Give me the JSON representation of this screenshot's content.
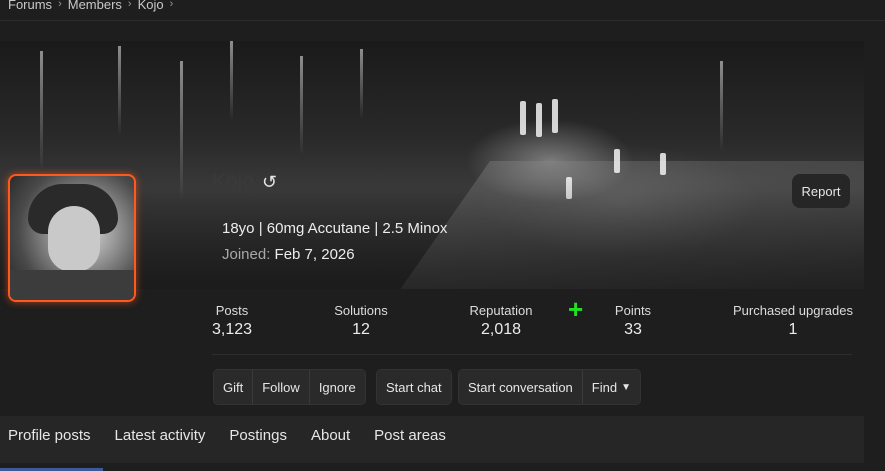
{
  "breadcrumb": [
    "Forums",
    "Members",
    "Kojo"
  ],
  "profile": {
    "username": "Kojo",
    "tagline": "18yo | 60mg Accutane | 2.5 Minox",
    "joined_label": "Joined:",
    "joined_value": "Feb 7, 2026",
    "report_label": "Report",
    "avatar_border_color": "#ff5a1e"
  },
  "stats": [
    {
      "label": "Posts",
      "value": "3,123"
    },
    {
      "label": "Solutions",
      "value": "12"
    },
    {
      "label": "Reputation",
      "value": "2,018"
    },
    {
      "label": "Points",
      "value": "33"
    },
    {
      "label": "Purchased upgrades",
      "value": "1"
    }
  ],
  "reputation_plus_icon": "+",
  "actions": {
    "gift": "Gift",
    "follow": "Follow",
    "ignore": "Ignore",
    "start_chat": "Start chat",
    "start_conversation": "Start conversation",
    "find": "Find"
  },
  "tabs": [
    "Profile posts",
    "Latest activity",
    "Postings",
    "About",
    "Post areas"
  ],
  "colors": {
    "accent_tab": "#3b5a9a",
    "reputation_plus": "#22e022"
  }
}
